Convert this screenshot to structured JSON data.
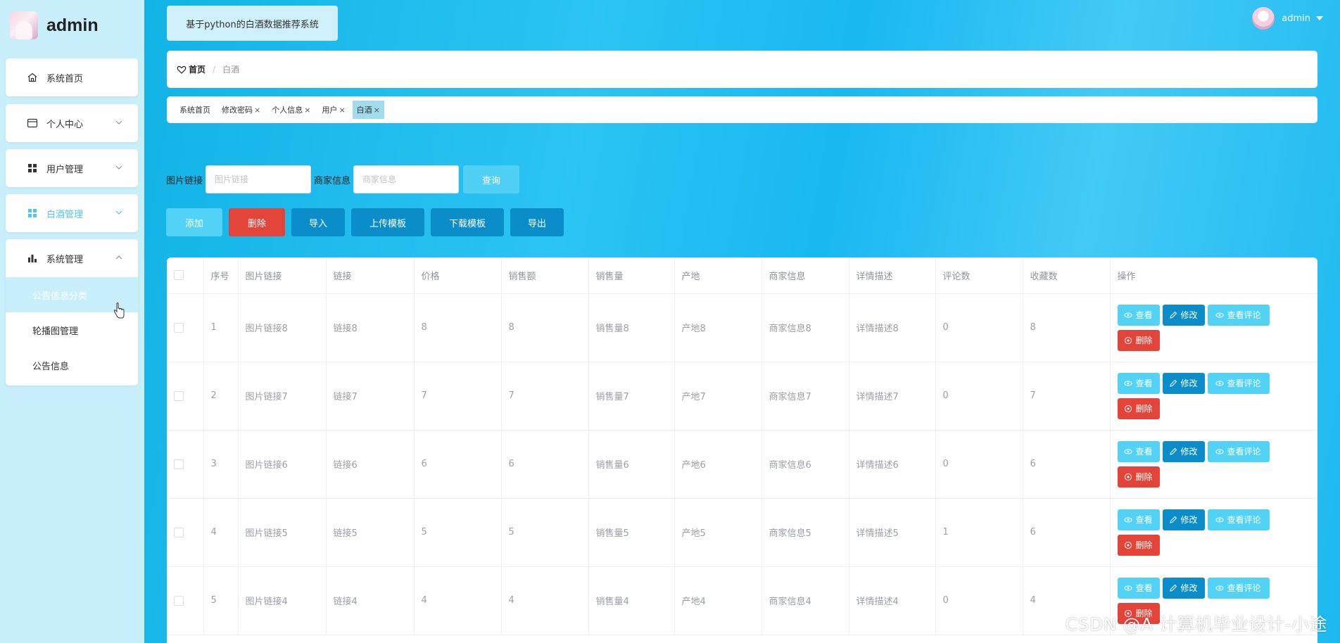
{
  "app": {
    "name": "admin",
    "system_title": "基于python的白酒数据推荐系统"
  },
  "sidebar": {
    "items": [
      {
        "label": "系统首页",
        "icon": "home-icon"
      },
      {
        "label": "个人中心",
        "icon": "card-icon"
      },
      {
        "label": "用户管理",
        "icon": "grid-icon"
      },
      {
        "label": "白酒管理",
        "icon": "grid-icon"
      },
      {
        "label": "系统管理",
        "icon": "bar-chart-icon"
      }
    ],
    "sub_items": [
      "公告信息分类",
      "轮播图管理",
      "公告信息"
    ]
  },
  "header": {
    "user": "admin"
  },
  "breadcrumb": {
    "home": "首页",
    "separator": "/",
    "current": "白酒"
  },
  "tags": [
    {
      "label": "系统首页",
      "closable": ""
    },
    {
      "label": "修改密码",
      "closable": "×"
    },
    {
      "label": "个人信息",
      "closable": "×"
    },
    {
      "label": "用户",
      "closable": "×"
    },
    {
      "label": "白酒",
      "closable": "×"
    }
  ],
  "search": {
    "field1_label": "图片链接",
    "field1_placeholder": "图片链接",
    "field2_label": "商家信息",
    "field2_placeholder": "商家信息",
    "query": "查询"
  },
  "actions": {
    "add": "添加",
    "delete": "删除",
    "import": "导入",
    "upload_template": "上传模板",
    "download_template": "下载模板",
    "export": "导出"
  },
  "table": {
    "columns": [
      "序号",
      "图片链接",
      "链接",
      "价格",
      "销售额",
      "销售量",
      "产地",
      "商家信息",
      "详情描述",
      "评论数",
      "收藏数",
      "操作"
    ],
    "op_labels": {
      "view": "查看",
      "edit": "修改",
      "comments": "查看评论",
      "delete": "删除"
    },
    "rows": [
      [
        "1",
        "图片链接8",
        "链接8",
        "8",
        "8",
        "销售量8",
        "产地8",
        "商家信息8",
        "详情描述8",
        "0",
        "8"
      ],
      [
        "2",
        "图片链接7",
        "链接7",
        "7",
        "7",
        "销售量7",
        "产地7",
        "商家信息7",
        "详情描述7",
        "0",
        "7"
      ],
      [
        "3",
        "图片链接6",
        "链接6",
        "6",
        "6",
        "销售量6",
        "产地6",
        "商家信息6",
        "详情描述6",
        "0",
        "6"
      ],
      [
        "4",
        "图片链接5",
        "链接5",
        "5",
        "5",
        "销售量5",
        "产地5",
        "商家信息5",
        "详情描述5",
        "1",
        "6"
      ],
      [
        "5",
        "图片链接4",
        "链接4",
        "4",
        "4",
        "销售量4",
        "产地4",
        "商家信息4",
        "详情描述4",
        "0",
        "4"
      ]
    ]
  },
  "watermark": "CSDN @A 计算机毕业设计-小途",
  "colors": {
    "accent": "#4fc7ea",
    "primary_dark": "#0a8dc8",
    "danger": "#e3443a",
    "sidebar_bg": "#c9eefc"
  }
}
